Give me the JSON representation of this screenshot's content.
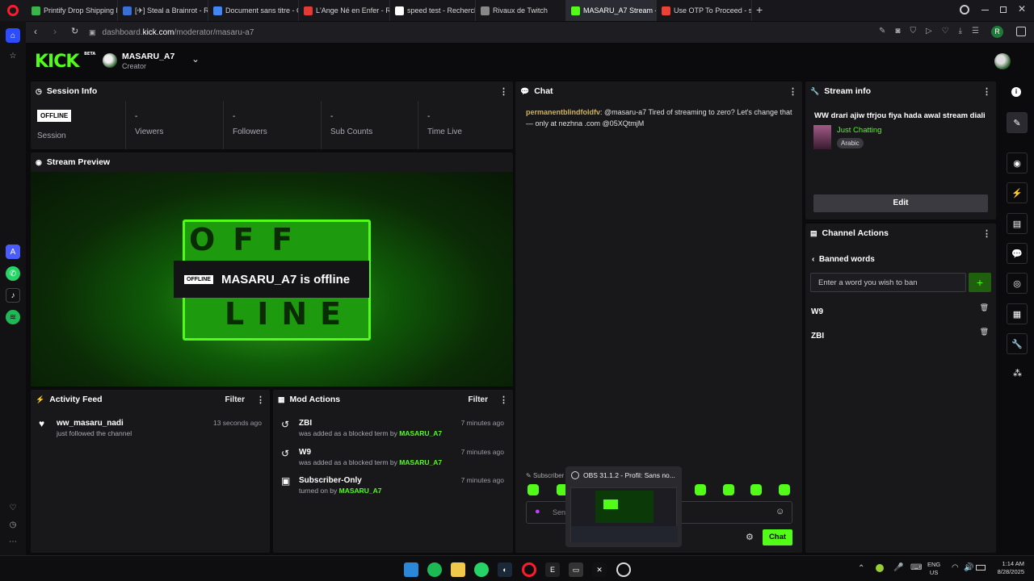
{
  "browser": {
    "tabs": [
      {
        "label": "Printify Drop Shipping Pri",
        "color": "#39b54a"
      },
      {
        "label": "[✈] Steal a Brainrot - Rob",
        "color": "#3a6fd6"
      },
      {
        "label": "Document sans titre - Goo",
        "color": "#4285f4"
      },
      {
        "label": "L'Ange Né en Enfer - Riad",
        "color": "#e53935"
      },
      {
        "label": "speed test - Recherche Go",
        "color": "#ffffff"
      },
      {
        "label": "Rivaux de Twitch",
        "color": "#888888"
      },
      {
        "label": "MASARU_A7 Stream - Kic",
        "color": "#53fc18"
      },
      {
        "label": "Use OTP To Proceed - sed",
        "color": "#ea4335"
      }
    ],
    "url_host": "dashboard.",
    "url_bold": "kick.com",
    "url_path": "/moderator/masaru-a7",
    "profile_letter": "R"
  },
  "header": {
    "logo": "KICK",
    "beta": "BETA",
    "channel_name": "MASARU_A7",
    "role": "Creator"
  },
  "session": {
    "title": "Session Info",
    "status_badge": "OFFLINE",
    "stats": [
      {
        "value": "",
        "label": "Session"
      },
      {
        "value": "-",
        "label": "Viewers"
      },
      {
        "value": "-",
        "label": "Followers"
      },
      {
        "value": "-",
        "label": "Sub Counts"
      },
      {
        "value": "-",
        "label": "Time Live"
      }
    ]
  },
  "preview": {
    "title": "Stream Preview",
    "badge": "OFFLINE",
    "message": "MASARU_A7 is offline",
    "top_word": "OFF",
    "bottom_word": "LINE"
  },
  "activity": {
    "title": "Activity Feed",
    "filter": "Filter",
    "items": [
      {
        "name": "ww_masaru_nadi",
        "sub": "just followed the channel",
        "time": "13 seconds ago"
      }
    ]
  },
  "mod_actions": {
    "title": "Mod Actions",
    "filter": "Filter",
    "items": [
      {
        "name": "ZBI",
        "sub": "was added as a blocked term by ",
        "by": "MASARU_A7",
        "time": "7 minutes ago"
      },
      {
        "name": "W9",
        "sub": "was added as a blocked term by ",
        "by": "MASARU_A7",
        "time": "7 minutes ago"
      },
      {
        "name": "Subscriber-Only",
        "sub": "turned on by ",
        "by": "MASARU_A7",
        "time": "7 minutes ago"
      }
    ]
  },
  "chat": {
    "title": "Chat",
    "messages": [
      {
        "user": "permanentblindfoldfv",
        "text": ": @masaru-a7 Tired of streaming to zero? Let's change that — only at nezhna .com @05XQtmjM"
      }
    ],
    "subscriber_label": "Subscriber",
    "input_placeholder": "Sen",
    "send_label": "Chat"
  },
  "stream_info": {
    "title": "Stream info",
    "stream_title": "WW drari ajiw tfrjou fiya hada awal stream diali",
    "category": "Just Chatting",
    "language_tag": "Arabic",
    "edit_label": "Edit"
  },
  "channel_actions": {
    "title": "Channel Actions",
    "section": "Banned words",
    "input_placeholder": "Enter a word you wish to ban",
    "words": [
      "W9",
      "ZBI"
    ]
  },
  "obs_popup": {
    "title": "OBS 31.1.2 - Profil: Sans no..."
  },
  "system_tray": {
    "lang_top": "ENG",
    "lang_bottom": "US",
    "time": "1:14 AM",
    "date": "8/28/2025"
  },
  "colors": {
    "accent": "#53fc18",
    "panel": "#18181b",
    "page": "#0b0b0d"
  }
}
